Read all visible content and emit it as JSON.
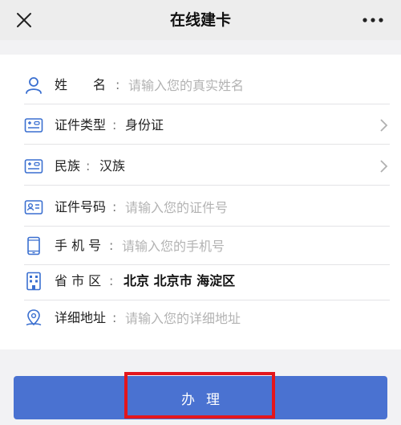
{
  "header": {
    "title": "在线建卡",
    "close_icon": "close-icon",
    "more_icon": "more-dots-icon"
  },
  "form": {
    "name": {
      "label": "姓　　名",
      "colon": ":",
      "placeholder": "请输入您的真实姓名",
      "icon": "person-icon"
    },
    "id_type": {
      "label": "证件类型",
      "colon": ":",
      "value": "身份证",
      "icon": "id-card-icon"
    },
    "ethnicity": {
      "label": "民族",
      "colon": ":",
      "value": "汉族",
      "icon": "id-card-icon"
    },
    "id_number": {
      "label": "证件号码",
      "colon": ":",
      "placeholder": "请输入您的证件号",
      "icon": "id-badge-icon"
    },
    "phone": {
      "label": "手 机 号",
      "colon": ":",
      "placeholder": "请输入您的手机号",
      "icon": "phone-icon"
    },
    "region": {
      "label": "省 市 区",
      "colon": ":",
      "value": "北京 北京市 海淀区",
      "icon": "building-icon"
    },
    "address": {
      "label": "详细地址",
      "colon": ":",
      "placeholder": "请输入您的详细地址",
      "icon": "location-pin-icon"
    }
  },
  "actions": {
    "submit_label": "办理"
  },
  "colors": {
    "accent": "#4a72d1",
    "icon": "#3a6fd0",
    "highlight": "#e4161c"
  }
}
